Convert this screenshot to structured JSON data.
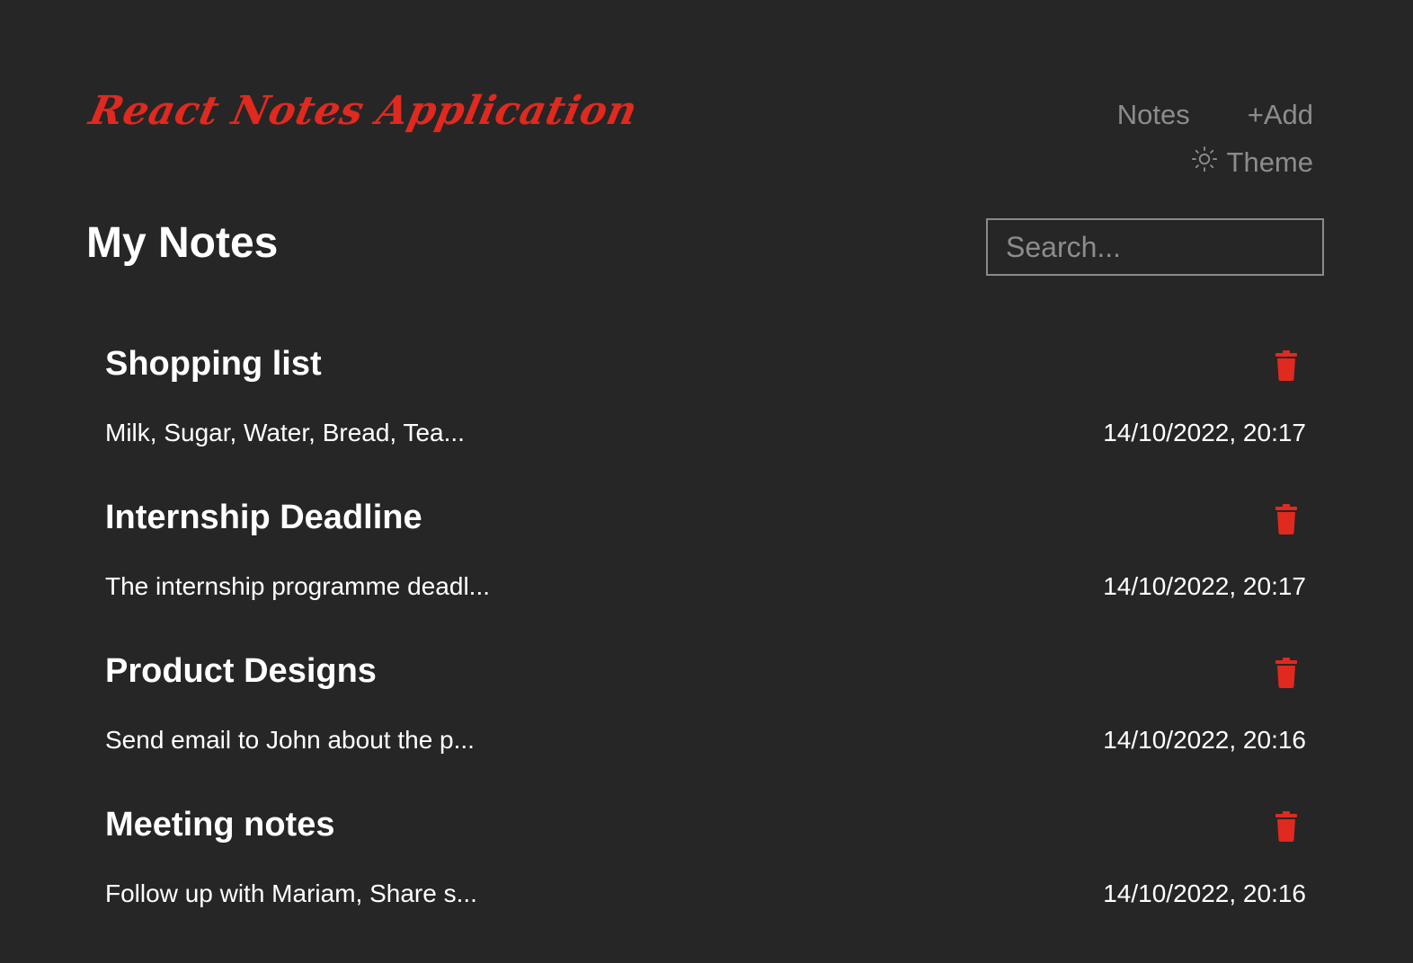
{
  "header": {
    "logo_text": "React Notes Application",
    "nav": {
      "notes_label": "Notes",
      "add_label": "+Add"
    },
    "theme_label": "Theme"
  },
  "main": {
    "title": "My Notes",
    "search": {
      "placeholder": "Search...",
      "value": ""
    },
    "notes": [
      {
        "title": "Shopping list",
        "preview": "Milk, Sugar, Water, Bread, Tea...",
        "date": "14/10/2022, 20:17"
      },
      {
        "title": "Internship Deadline",
        "preview": "The internship programme deadl...",
        "date": "14/10/2022, 20:17"
      },
      {
        "title": "Product Designs",
        "preview": "Send email to John about the p...",
        "date": "14/10/2022, 20:16"
      },
      {
        "title": "Meeting notes",
        "preview": "Follow up with Mariam, Share s...",
        "date": "14/10/2022, 20:16"
      }
    ]
  },
  "icons": {
    "theme": "sun-icon",
    "delete": "trash-icon"
  },
  "colors": {
    "background": "#262626",
    "accent": "#e0291f",
    "muted": "#8c8c8c",
    "text": "#ffffff"
  }
}
